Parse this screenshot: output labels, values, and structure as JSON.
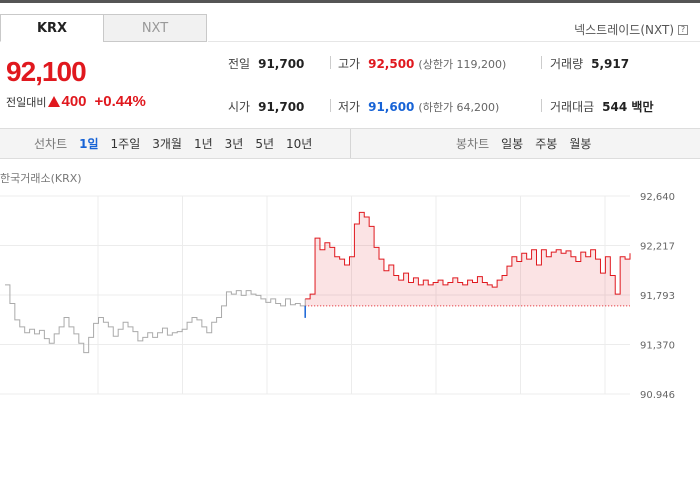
{
  "tabs": [
    {
      "label": "KRX",
      "active": true
    },
    {
      "label": "NXT",
      "active": false
    }
  ],
  "nxt_link": "넥스트레이드(NXT)",
  "price": {
    "current": "92,100",
    "change_label": "전일대비",
    "change": "400",
    "change_pct": "+0.44%"
  },
  "stats": {
    "prev_close": {
      "label": "전일",
      "value": "91,700"
    },
    "high": {
      "label": "고가",
      "value": "92,500",
      "sub": "(상한가 119,200)"
    },
    "volume": {
      "label": "거래량",
      "value": "5,917"
    },
    "open": {
      "label": "시가",
      "value": "91,700"
    },
    "low": {
      "label": "저가",
      "value": "91,600",
      "sub": "(하한가 64,200)"
    },
    "amount": {
      "label": "거래대금",
      "value": "544 백만"
    }
  },
  "toolbar": {
    "line_label": "선차트",
    "line_periods": [
      "1일",
      "1주일",
      "3개월",
      "1년",
      "3년",
      "5년",
      "10년"
    ],
    "active_period": "1일",
    "candle_label": "봉차트",
    "candle_periods": [
      "일봉",
      "주봉",
      "월봉"
    ]
  },
  "chart_source": "한국거래소(KRX)",
  "colors": {
    "up": "#e0181e",
    "down": "#1763d6",
    "prev": "#aaaaaa"
  },
  "chart_data": {
    "type": "line",
    "title": "",
    "xlabel": "",
    "ylabel": "",
    "ylim": [
      90946,
      92640
    ],
    "y_ticks": [
      92640,
      92217,
      91793,
      91370,
      90946
    ],
    "y_tick_labels": [
      "92,640",
      "92,217",
      "91,793",
      "91,370",
      "90,946"
    ],
    "reference_price": 91700,
    "series": [
      {
        "values": [
          91880,
          91720,
          91580,
          91520,
          91470,
          91500,
          91460,
          91490,
          91420,
          91380,
          91460,
          91520,
          91600,
          91520,
          91460,
          91380,
          91300,
          91430,
          91550,
          91600,
          91560,
          91520,
          91440,
          91500,
          91560,
          91520,
          91480,
          91400,
          91430,
          91470,
          91430,
          91470,
          91510,
          91450,
          91470,
          91480,
          91500,
          91560,
          91600,
          91580,
          91520,
          91470,
          91560,
          91600,
          91700,
          91820,
          91800,
          91830,
          91790,
          91830,
          91800,
          91790,
          91760,
          91730,
          91760,
          91720,
          91700,
          91760,
          91710,
          91720,
          91700,
          91760,
          91800,
          92280,
          92180,
          92240,
          92200,
          92120,
          92100,
          92050,
          92120,
          92400,
          92500,
          92460,
          92380,
          92200,
          92100,
          92000,
          92050,
          91960,
          91920,
          91980,
          91900,
          91940,
          91880,
          91920,
          91880,
          91900,
          91920,
          91880,
          91900,
          91940,
          91900,
          91880,
          91920,
          91900,
          91950,
          91900,
          91880,
          91860,
          91920,
          91960,
          92040,
          92120,
          92080,
          92150,
          92100,
          92180,
          92050,
          92180,
          92120,
          92160,
          92180,
          92150,
          92170,
          92120,
          92080,
          92160,
          92120,
          92180,
          92100,
          91980,
          92120,
          91960,
          91800,
          92120,
          92100,
          92150
        ]
      }
    ]
  }
}
